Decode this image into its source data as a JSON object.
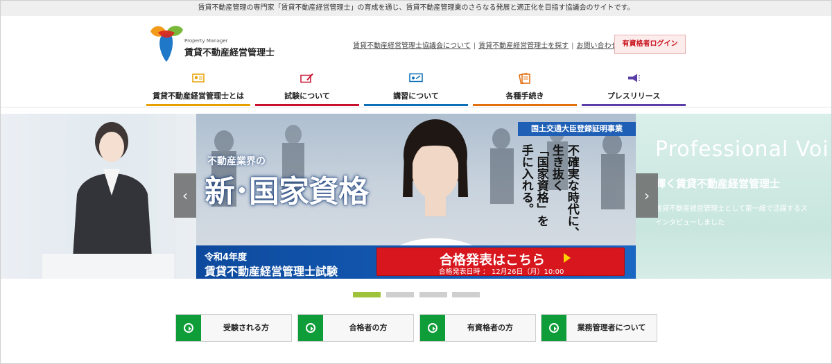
{
  "topbar": {
    "text": "賃貸不動産管理の専門家「賃貸不動産経営管理士」の育成を通じ、賃貸不動産管理業のさらなる発展と適正化を目指す協議会のサイトです。"
  },
  "logo": {
    "small": "Property Manager",
    "main": "賃貸不動産経営管理士"
  },
  "util_links": {
    "about": "賃貸不動産経営管理士協議会について",
    "search": "賃貸不動産経営管理士を探す",
    "contact": "お問い合わせ",
    "separator": "|"
  },
  "login": {
    "label": "有資格者ログイン"
  },
  "gnav": {
    "items": [
      {
        "label": "賃貸不動産経営管理士とは",
        "icon": "certificate-icon",
        "color": "#e8a000"
      },
      {
        "label": "試験について",
        "icon": "pencil-book-icon",
        "color": "#c8102e"
      },
      {
        "label": "講習について",
        "icon": "presentation-icon",
        "color": "#0c6fb8"
      },
      {
        "label": "各種手続き",
        "icon": "documents-icon",
        "color": "#e36f0f"
      },
      {
        "label": "プレスリリース",
        "icon": "megaphone-icon",
        "color": "#5b3ea8"
      }
    ]
  },
  "slide": {
    "badge": "国土交通大臣登録証明事業",
    "line1": "不動産業界の",
    "line2": "新･国家資格",
    "vert1": "不確実な時代に、",
    "vert2": "生き抜く",
    "vert3": "「国家資格」を",
    "vert4": "手に入れる。",
    "exam_year": "令和4年度",
    "exam_name": "賃貸不動産経営管理士試験",
    "result_label": "合格発表はこちら",
    "result_date": "合格発表日時 ： 12月26日（月）10:00"
  },
  "side_right": {
    "title": "Professional Voi",
    "sub": "輝く賃貸不動産経営管理士",
    "desc1": "賃貸不動産経営管理士として第一線で活躍するス",
    "desc2": "インタビューしました"
  },
  "arrows": {
    "prev": "‹",
    "next": "›"
  },
  "cta": {
    "items": [
      {
        "label": "受験される方"
      },
      {
        "label": "合格者の方"
      },
      {
        "label": "有資格者の方"
      },
      {
        "label": "業務管理者について"
      }
    ]
  },
  "colors": {
    "accent_green": "#0f9d3a",
    "login_red": "#c9141e",
    "slide_blue": "#1f5fb5",
    "dot_active": "#9ec33b"
  }
}
